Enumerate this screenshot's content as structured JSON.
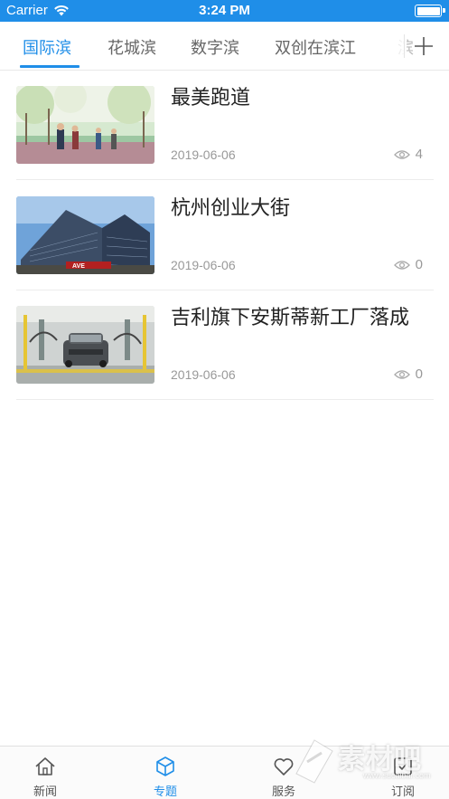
{
  "status_bar": {
    "carrier": "Carrier",
    "time": "3:24 PM",
    "icons": [
      "wifi-icon",
      "battery-icon"
    ]
  },
  "tabs": [
    {
      "label": "国际滨",
      "active": true
    },
    {
      "label": "花城滨",
      "active": false
    },
    {
      "label": "数字滨",
      "active": false
    },
    {
      "label": "双创在滨江",
      "active": false
    }
  ],
  "accent_color": "#1f8ee8",
  "news": [
    {
      "title": "最美跑道",
      "date": "2019-06-06",
      "views": "4",
      "thumb": "park-photo"
    },
    {
      "title": "杭州创业大街",
      "date": "2019-06-06",
      "views": "0",
      "thumb": "building-photo"
    },
    {
      "title": "吉利旗下安斯蒂新工厂落成",
      "date": "2019-06-06",
      "views": "0",
      "thumb": "factory-taxi-photo"
    }
  ],
  "bottom_nav": [
    {
      "label": "新闻",
      "icon": "home-icon",
      "active": false
    },
    {
      "label": "专题",
      "icon": "cube-icon",
      "active": true
    },
    {
      "label": "服务",
      "icon": "heart-icon",
      "active": false
    },
    {
      "label": "订阅",
      "icon": "subscribe-icon",
      "active": false
    }
  ],
  "watermark": {
    "text": "素材吧",
    "url": "www.sucaibar.com"
  }
}
